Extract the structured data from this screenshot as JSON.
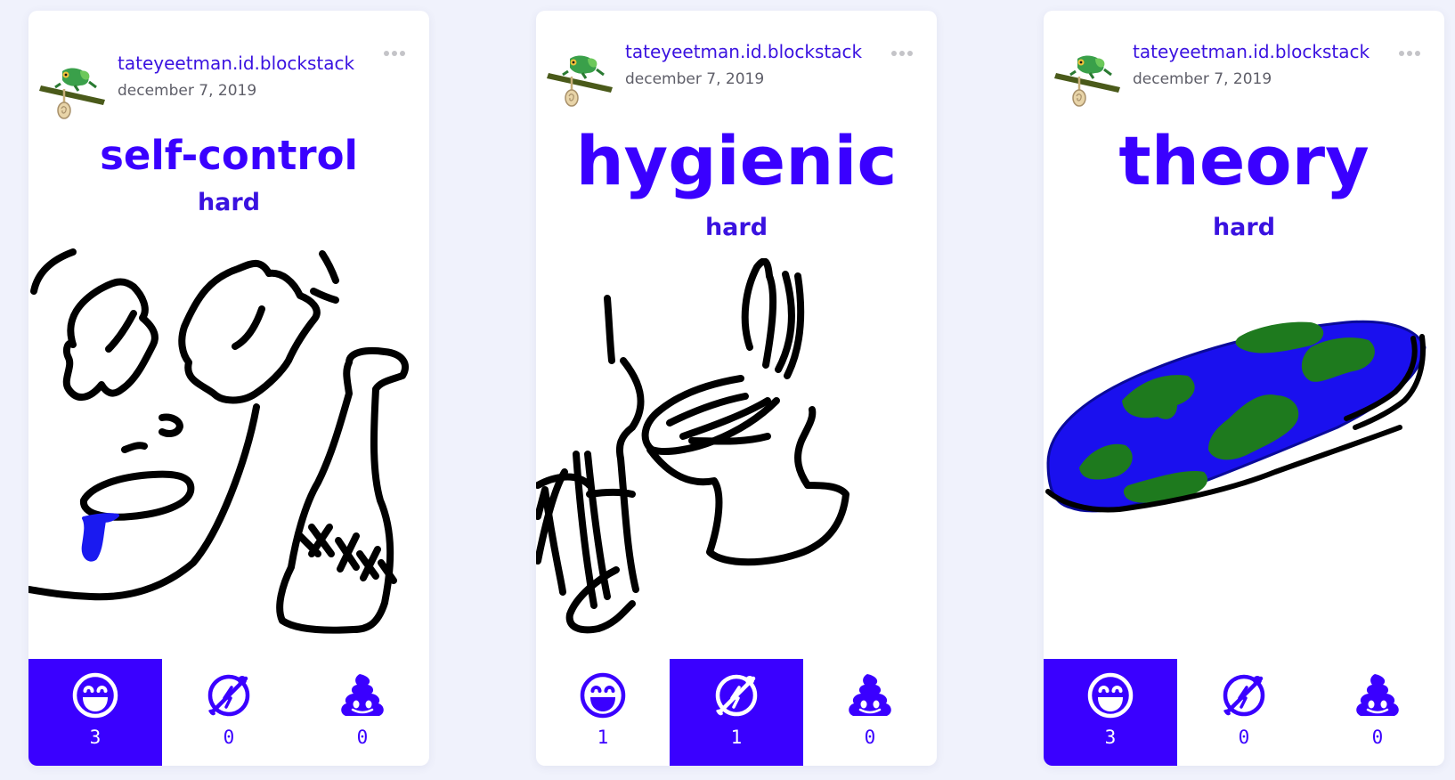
{
  "posts": [
    {
      "author": "tateyeetman.id.blockstack",
      "date": "december 7, 2019",
      "word": "self-control",
      "difficulty": "hard",
      "reactions": [
        {
          "icon": "grinning-face-icon",
          "count": "3",
          "active": true
        },
        {
          "icon": "crying-laughing-face-icon",
          "count": "0",
          "active": false
        },
        {
          "icon": "poop-icon",
          "count": "0",
          "active": false
        }
      ]
    },
    {
      "author": "tateyeetman.id.blockstack",
      "date": "december 7, 2019",
      "word": "hygienic",
      "difficulty": "hard",
      "reactions": [
        {
          "icon": "grinning-face-icon",
          "count": "1",
          "active": false
        },
        {
          "icon": "crying-laughing-face-icon",
          "count": "1",
          "active": true
        },
        {
          "icon": "poop-icon",
          "count": "0",
          "active": false
        }
      ]
    },
    {
      "author": "tateyeetman.id.blockstack",
      "date": "december 7, 2019",
      "word": "theory",
      "difficulty": "hard",
      "reactions": [
        {
          "icon": "grinning-face-icon",
          "count": "3",
          "active": true
        },
        {
          "icon": "crying-laughing-face-icon",
          "count": "0",
          "active": false
        },
        {
          "icon": "poop-icon",
          "count": "0",
          "active": false
        }
      ]
    }
  ],
  "colors": {
    "accent": "#3a00ff",
    "page_background": "#f0f2fc",
    "card_background": "#ffffff",
    "date_text": "#5e5e68"
  }
}
